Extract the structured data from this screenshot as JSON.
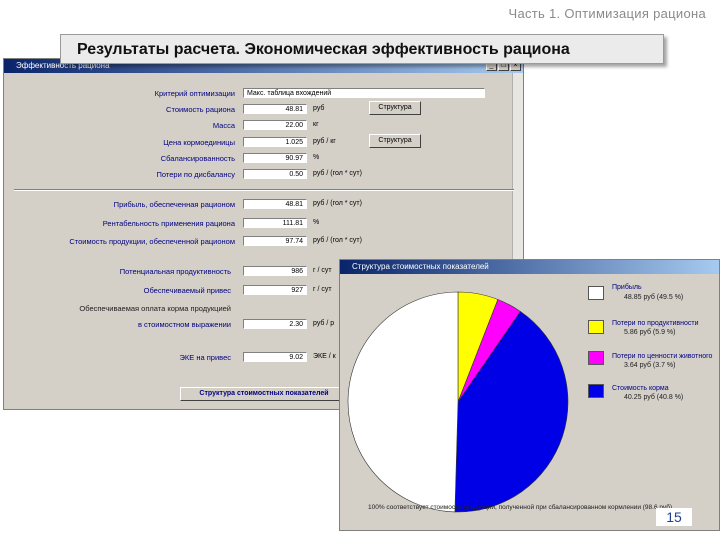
{
  "chapter": "Часть 1. Оптимизация рациона",
  "banner": "Результаты расчета. Экономическая эффективность рациона",
  "window1": {
    "title": "Эффективность рациона",
    "rows": {
      "criterion": {
        "label": "Критерий оптимизации",
        "value": "Макс. таблица вхождений"
      },
      "cost": {
        "label": "Стоимость рациона",
        "value": "48.81",
        "unit": "руб"
      },
      "mass": {
        "label": "Масса",
        "value": "22.00",
        "unit": "кг"
      },
      "feed_price": {
        "label": "Цена кормоединицы",
        "value": "1.025",
        "unit": "руб / кг"
      },
      "balance": {
        "label": "Сбалансированность",
        "value": "90.97",
        "unit": "%"
      },
      "loss": {
        "label": "Потери по дисбалансу",
        "value": "0.50",
        "unit": "руб / (гол * сут)"
      },
      "profit": {
        "label": "Прибыль, обеспеченная рационом",
        "value": "48.81",
        "unit": "руб / (гол * сут)"
      },
      "profitability": {
        "label": "Рентабельность применения рациона",
        "value": "111.81",
        "unit": "%"
      },
      "product_cost": {
        "label": "Стоимость продукции, обеспеченной рационом",
        "value": "97.74",
        "unit": "руб / (гол * сут)"
      },
      "potential": {
        "label": "Потенциальная продуктивность",
        "value": "986",
        "unit": "г / сут"
      },
      "gain": {
        "label": "Обеспечиваемый привес",
        "value": "927",
        "unit": "г / сут"
      },
      "pay_note": "Обеспечиваемая оплата корма продукцией",
      "pay": {
        "label": "в стоимостном выражении",
        "value": "2.30",
        "unit": "руб / р"
      },
      "eke": {
        "label": "ЭКЕ на привес",
        "value": "9.02",
        "unit": "ЭКЕ / к"
      }
    },
    "buttons": {
      "structure1": "Структура",
      "structure2": "Структура",
      "bottom": "Структура стоимостных показателей"
    }
  },
  "window2": {
    "title": "Структура стоимостных показателей",
    "legend": [
      {
        "name": "Прибыль",
        "value": "48.85 руб  (49.5 %)",
        "color": "#ffffff"
      },
      {
        "name": "Потери по продуктивности",
        "value": "5.86 руб  (5.9 %)",
        "color": "#ffff00"
      },
      {
        "name": "Потери по ценности животного",
        "value": "3.64 руб  (3.7 %)",
        "color": "#ff00ff"
      },
      {
        "name": "Стоимость корма",
        "value": "40.25 руб  (40.8 %)",
        "color": "#0000e6"
      }
    ],
    "note": "100% соответствует стоимости продукции, полученной при сбалансированном кормлении (98.6 руб)"
  },
  "page_number": "15"
}
